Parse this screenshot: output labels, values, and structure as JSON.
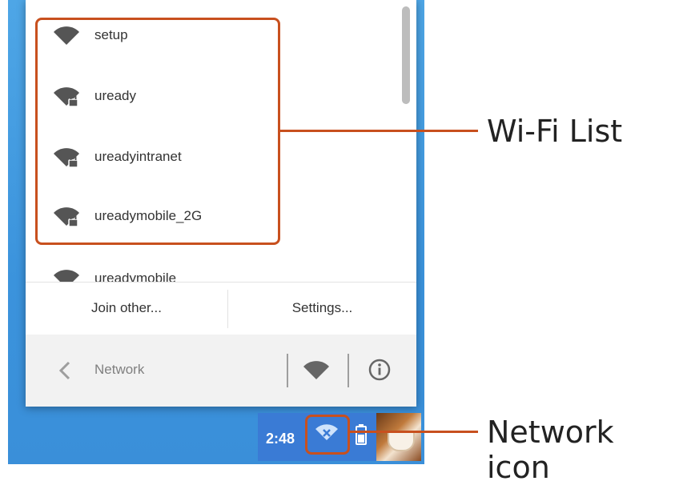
{
  "wifi_networks": [
    {
      "name": "setup",
      "locked": false
    },
    {
      "name": "uready",
      "locked": true
    },
    {
      "name": "ureadyintranet",
      "locked": true
    },
    {
      "name": "ureadymobile_2G",
      "locked": true
    },
    {
      "name": "ureadymobile",
      "locked": false
    }
  ],
  "buttons": {
    "join_other": "Join other...",
    "settings": "Settings..."
  },
  "nav": {
    "title": "Network"
  },
  "shelf": {
    "time": "2:48"
  },
  "annotations": {
    "wifi_list": "Wi-Fi List",
    "network_icon": "Network icon"
  },
  "colors": {
    "callout": "#c8501e",
    "desktop": "#3b93dc",
    "shelf": "#3a7bd5"
  }
}
